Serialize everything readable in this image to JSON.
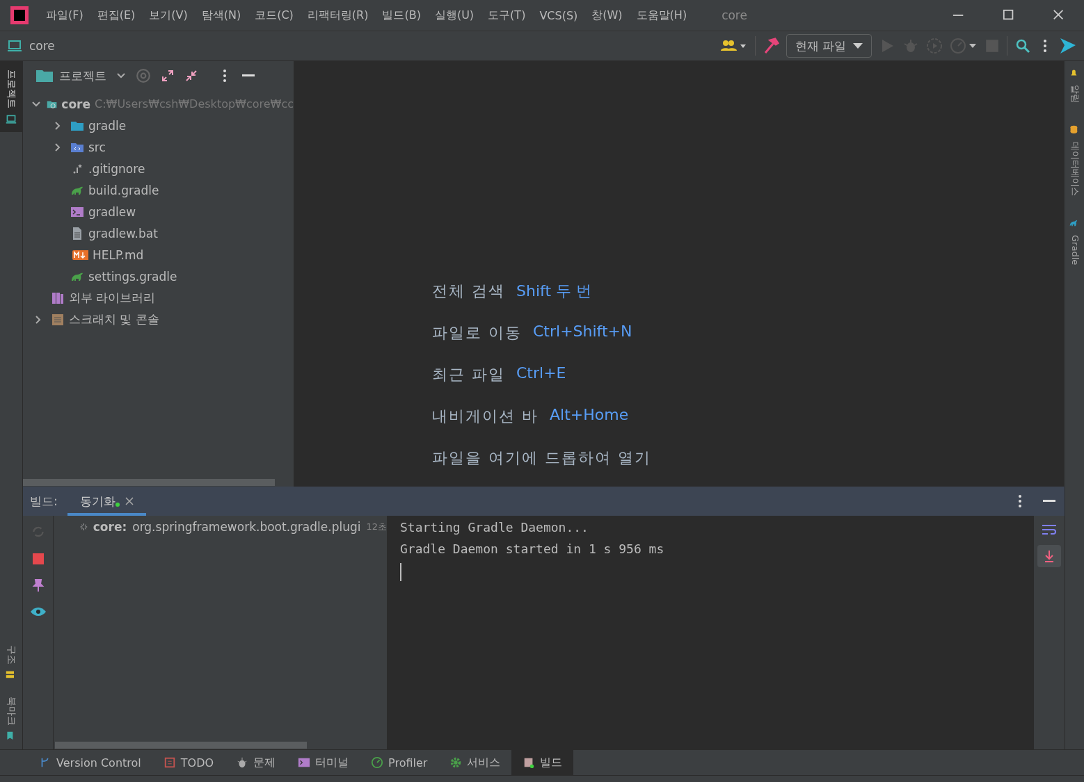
{
  "menu_bar": {
    "items": [
      "파일(F)",
      "편집(E)",
      "보기(V)",
      "탐색(N)",
      "코드(C)",
      "리팩터링(R)",
      "빌드(B)",
      "실행(U)",
      "도구(T)",
      "VCS(S)",
      "창(W)",
      "도움말(H)"
    ],
    "title": "core"
  },
  "nav_bar": {
    "project": "core",
    "run_config": "현재 파일"
  },
  "left_strip": {
    "top": [
      {
        "label": "프로젝트",
        "selected": true
      }
    ],
    "bottom": [
      {
        "label": "구조",
        "selected": false
      },
      {
        "label": "북마크",
        "selected": false
      }
    ]
  },
  "right_strip": [
    {
      "label": "알림",
      "kind": "bell"
    },
    {
      "label": "데이터베이스",
      "kind": "database"
    },
    {
      "label": "Gradle",
      "kind": "gradle"
    }
  ],
  "project_panel": {
    "title": "프로젝트",
    "tree": [
      {
        "name": "core",
        "path": "C:₩Users₩csh₩Desktop₩core₩cc",
        "kind": "module",
        "expanded": true,
        "children": [
          {
            "name": "gradle",
            "kind": "folder",
            "expanded": false
          },
          {
            "name": "src",
            "kind": "src",
            "expanded": false
          },
          {
            "name": ".gitignore",
            "kind": "ignore"
          },
          {
            "name": "build.gradle",
            "kind": "gradle"
          },
          {
            "name": "gradlew",
            "kind": "shell"
          },
          {
            "name": "gradlew.bat",
            "kind": "file"
          },
          {
            "name": "HELP.md",
            "kind": "md"
          },
          {
            "name": "settings.gradle",
            "kind": "gradle"
          }
        ]
      },
      {
        "name": "외부 라이브러리",
        "kind": "library"
      },
      {
        "name": "스크래치 및 콘솔",
        "kind": "scratch",
        "expanded": false
      }
    ]
  },
  "editor_hints": [
    {
      "label": "전체 검색",
      "shortcut": "Shift 두 번"
    },
    {
      "label": "파일로 이동",
      "shortcut": "Ctrl+Shift+N"
    },
    {
      "label": "최근 파일",
      "shortcut": "Ctrl+E"
    },
    {
      "label": "내비게이션 바",
      "shortcut": "Alt+Home"
    },
    {
      "label": "파일을 여기에 드롭하여 열기"
    }
  ],
  "build_panel": {
    "label": "빌드:",
    "tabs": [
      {
        "label": "동기화",
        "selected": true
      }
    ],
    "task": {
      "module": "core:",
      "text": "org.springframework.boot.gradle.plugi",
      "time": "12초"
    },
    "console": [
      "Starting Gradle Daemon...",
      "Gradle Daemon started in 1 s 956 ms"
    ]
  },
  "tool_windows": [
    {
      "label": "Version Control",
      "kind": "vcs",
      "selected": false
    },
    {
      "label": "TODO",
      "kind": "todo",
      "selected": false
    },
    {
      "label": "문제",
      "kind": "problems",
      "selected": false
    },
    {
      "label": "터미널",
      "kind": "terminal",
      "selected": false
    },
    {
      "label": "Profiler",
      "kind": "profiler",
      "selected": false
    },
    {
      "label": "서비스",
      "kind": "services",
      "selected": false
    },
    {
      "label": "빌드",
      "kind": "build",
      "selected": true
    }
  ]
}
